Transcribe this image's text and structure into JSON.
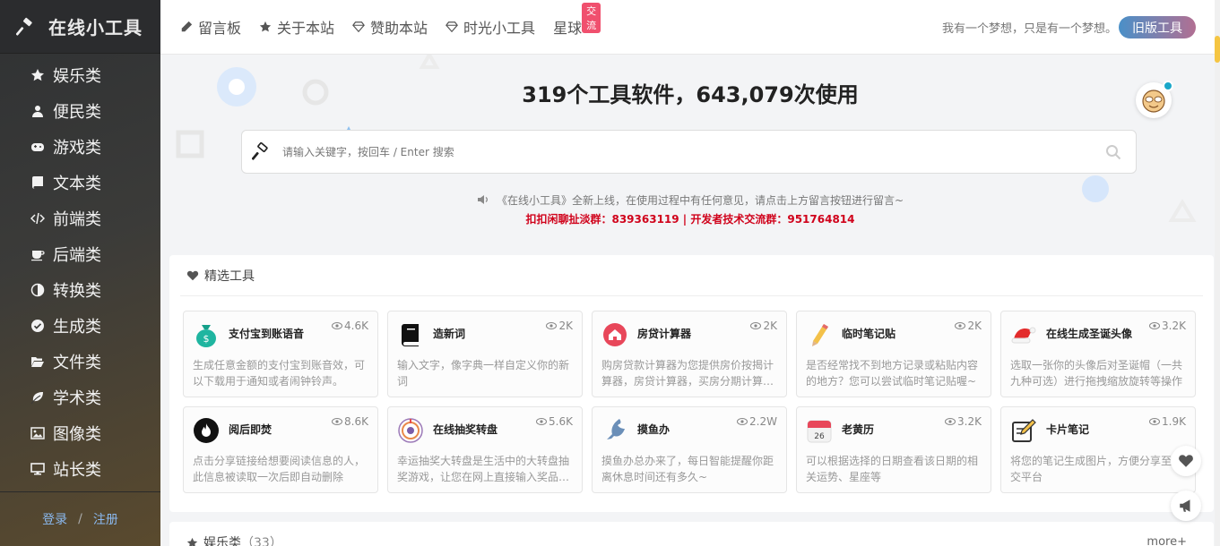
{
  "app": {
    "title": "在线小工具",
    "logo_icon": "hammer-icon"
  },
  "sidebar": {
    "items": [
      {
        "label": "娱乐类",
        "icon": "star-icon"
      },
      {
        "label": "便民类",
        "icon": "user-icon"
      },
      {
        "label": "游戏类",
        "icon": "gamepad-icon"
      },
      {
        "label": "文本类",
        "icon": "book-icon"
      },
      {
        "label": "前端类",
        "icon": "code-icon"
      },
      {
        "label": "后端类",
        "icon": "coffee-icon"
      },
      {
        "label": "转换类",
        "icon": "half-circle-icon"
      },
      {
        "label": "生成类",
        "icon": "check-circle-icon"
      },
      {
        "label": "文件类",
        "icon": "folder-open-icon"
      },
      {
        "label": "学术类",
        "icon": "leaf-icon"
      },
      {
        "label": "图像类",
        "icon": "image-icon"
      },
      {
        "label": "站长类",
        "icon": "monitor-icon"
      }
    ],
    "login": "登录",
    "separator": "/",
    "register": "注册"
  },
  "topnav": {
    "items": [
      {
        "label": "留言板",
        "icon": "pencil-icon"
      },
      {
        "label": "关于本站",
        "icon": "star-icon"
      },
      {
        "label": "赞助本站",
        "icon": "diamond-icon"
      },
      {
        "label": "时光小工具",
        "icon": "diamond-icon"
      },
      {
        "label": "星球",
        "icon": ""
      }
    ],
    "badge": "交流",
    "motto": "我有一个梦想，只是有一个梦想。",
    "old_version": "旧版工具"
  },
  "hero": {
    "headline": "319个工具软件，643,079次使用",
    "search_placeholder": "请输入关键字，按回车 / Enter 搜索",
    "notice": "《在线小工具》全新上线，在使用过程中有任何意见，请点击上方留言按钮进行留言~",
    "groups": "扣扣闲聊扯淡群：839363119 | 开发者技术交流群：951764814"
  },
  "featured": {
    "title": "精选工具",
    "cards": [
      {
        "name": "支付宝到账语音",
        "views": "4.6K",
        "desc": "生成任意金额的支付宝到账音效，可以下载用于通知或者闹钟铃声。",
        "icon": "money-bag-icon"
      },
      {
        "name": "造新词",
        "views": "2K",
        "desc": "输入文字，像字典一样自定义你的新词",
        "icon": "black-book-icon"
      },
      {
        "name": "房贷计算器",
        "views": "2K",
        "desc": "购房贷款计算器为您提供房价按揭计算器，房贷计算器，买房分期计算器等服务",
        "icon": "house-icon"
      },
      {
        "name": "临时笔记贴",
        "views": "2K",
        "desc": "是否经常找不到地方记录或粘贴内容的地方？您可以尝试临时笔记贴喔~",
        "icon": "pencil-icon"
      },
      {
        "name": "在线生成圣诞头像",
        "views": "3.2K",
        "desc": "选取一张你的头像后对圣诞帽（一共九种可选）进行拖拽缩放旋转等操作",
        "icon": "santa-hat-icon"
      },
      {
        "name": "阅后即焚",
        "views": "8.6K",
        "desc": "点击分享链接给想要阅读信息的人，此信息被读取一次后即自动删除",
        "icon": "fire-icon"
      },
      {
        "name": "在线抽奖转盘",
        "views": "5.6K",
        "desc": "幸运抽奖大转盘是生活中的大转盘抽奖游戏，让您在网上直接输入奖品进行抽奖",
        "icon": "wheel-icon"
      },
      {
        "name": "摸鱼办",
        "views": "2.2W",
        "desc": "摸鱼办总办来了，每日智能提醒你距离休息时间还有多久~",
        "icon": "fish-icon"
      },
      {
        "name": "老黄历",
        "views": "3.2K",
        "desc": "可以根据选择的日期查看该日期的相关运势、星座等",
        "icon": "calendar-icon"
      },
      {
        "name": "卡片笔记",
        "views": "1.9K",
        "desc": "将您的笔记生成图片，方便分享至社交平台",
        "icon": "note-icon"
      }
    ]
  },
  "section2": {
    "title": "娱乐类",
    "count": "（33）",
    "more": "more+"
  }
}
